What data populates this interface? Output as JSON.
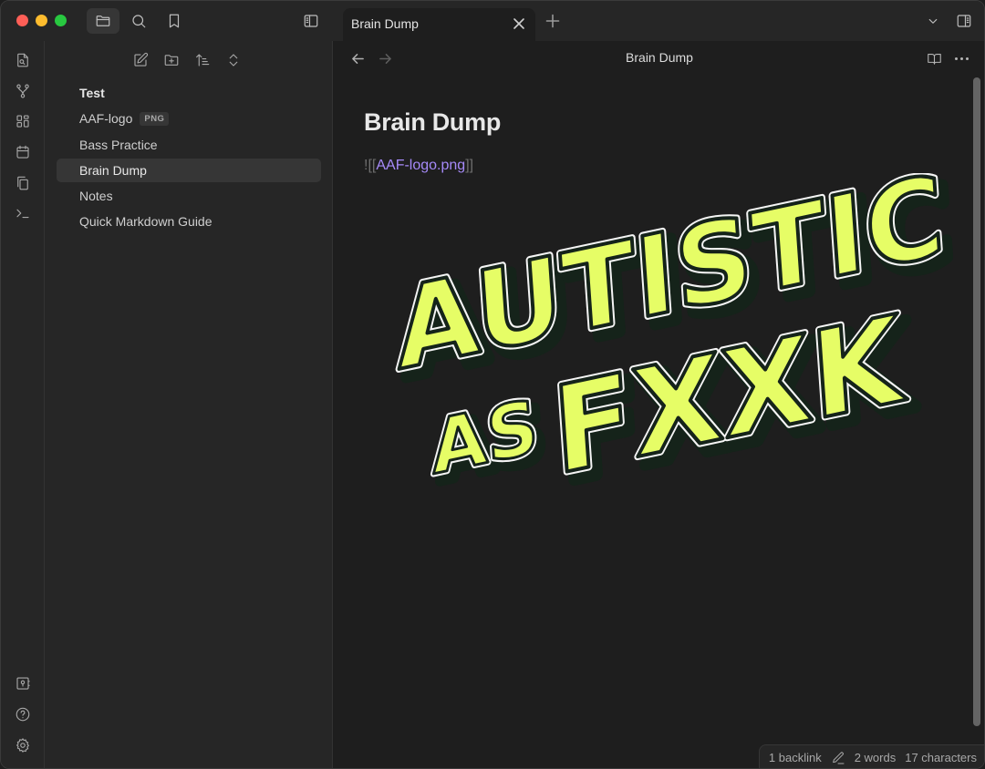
{
  "window": {
    "controls": [
      "close",
      "minimize",
      "maximize"
    ]
  },
  "titlebar": {
    "left_buttons": [
      {
        "name": "file-explorer",
        "icon": "folder-icon",
        "active": true
      },
      {
        "name": "search",
        "icon": "search-icon",
        "active": false
      },
      {
        "name": "bookmarks",
        "icon": "bookmark-icon",
        "active": false
      }
    ],
    "toggle_left_sidebar_icon": "sidebar-left-icon",
    "tabs": [
      {
        "title": "Brain Dump",
        "active": true
      }
    ],
    "new_tab_icon": "plus-icon",
    "tab_list_icon": "chevron-down-icon",
    "toggle_right_sidebar_icon": "sidebar-right-icon"
  },
  "ribbon": {
    "top": [
      {
        "name": "quick-switcher",
        "icon": "file-search-icon"
      },
      {
        "name": "graph-view",
        "icon": "graph-icon"
      },
      {
        "name": "canvas",
        "icon": "layout-grid-icon"
      },
      {
        "name": "daily-note",
        "icon": "calendar-icon"
      },
      {
        "name": "templates",
        "icon": "copy-icon"
      },
      {
        "name": "command-palette",
        "icon": "terminal-icon"
      }
    ],
    "bottom": [
      {
        "name": "vault-switcher",
        "icon": "vault-icon"
      },
      {
        "name": "help",
        "icon": "help-circle-icon"
      },
      {
        "name": "settings",
        "icon": "gear-icon"
      }
    ]
  },
  "explorer": {
    "actions": [
      {
        "name": "new-note",
        "icon": "edit-icon"
      },
      {
        "name": "new-folder",
        "icon": "folder-plus-icon"
      },
      {
        "name": "sort",
        "icon": "sort-icon"
      },
      {
        "name": "collapse-all",
        "icon": "chevrons-up-down-icon"
      }
    ],
    "vault_name": "Test",
    "files": [
      {
        "label": "AAF-logo",
        "badge": "PNG",
        "selected": false
      },
      {
        "label": "Bass Practice",
        "badge": null,
        "selected": false
      },
      {
        "label": "Brain Dump",
        "badge": null,
        "selected": true
      },
      {
        "label": "Notes",
        "badge": null,
        "selected": false
      },
      {
        "label": "Quick Markdown Guide",
        "badge": null,
        "selected": false
      }
    ]
  },
  "editor": {
    "view_title": "Brain Dump",
    "note_title": "Brain Dump",
    "embed": {
      "prefix": "![[",
      "link": "AAF-logo.png",
      "suffix": "]]"
    },
    "image_text": {
      "line1": "AUTISTIC",
      "line2_small": "AS",
      "line2_big": "FXXK"
    },
    "colors": {
      "link": "#a68af9",
      "logo_fill": "#e6fd66",
      "logo_outline": "#15231a"
    }
  },
  "statusbar": {
    "backlinks": "1 backlink",
    "words": "2 words",
    "characters": "17 characters"
  }
}
